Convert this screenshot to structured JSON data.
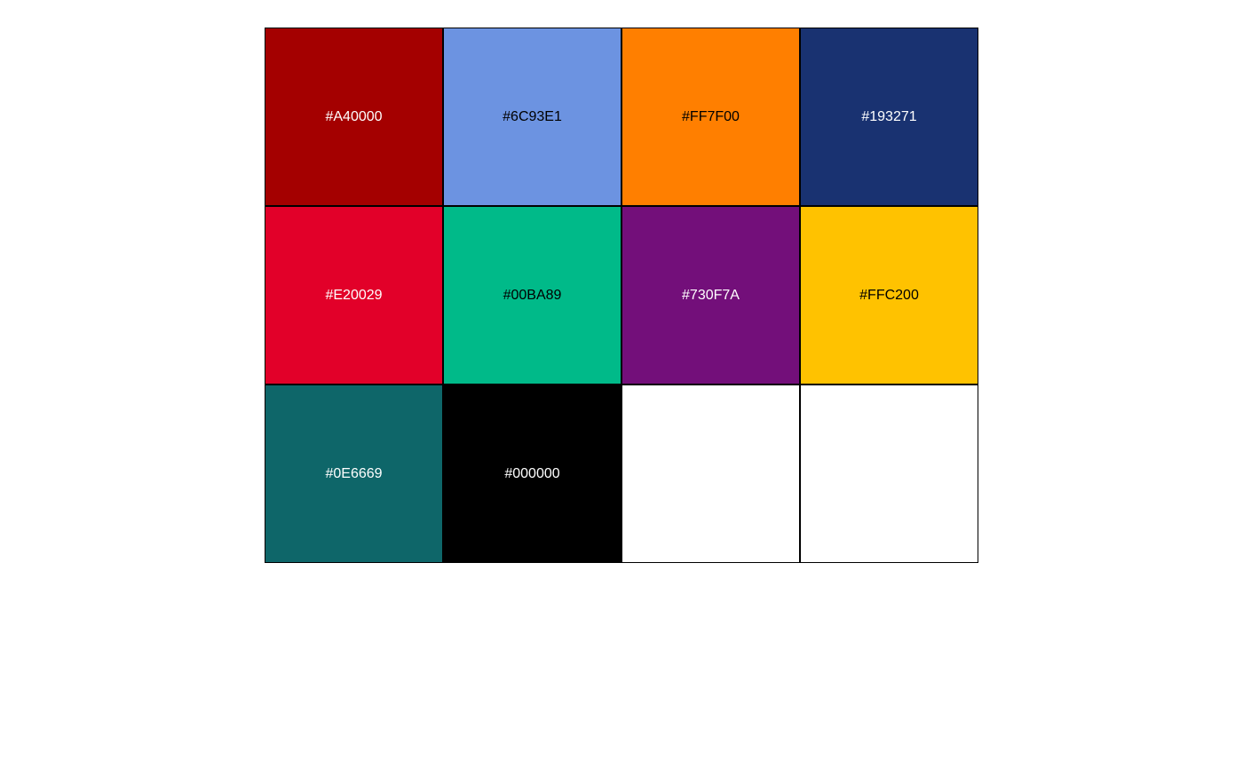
{
  "swatches": [
    {
      "hex": "#A40000",
      "label": "#A40000",
      "text_color": "#FFFFFF"
    },
    {
      "hex": "#6C93E1",
      "label": "#6C93E1",
      "text_color": "#000000"
    },
    {
      "hex": "#FF7F00",
      "label": "#FF7F00",
      "text_color": "#000000"
    },
    {
      "hex": "#193271",
      "label": "#193271",
      "text_color": "#FFFFFF"
    },
    {
      "hex": "#E20029",
      "label": "#E20029",
      "text_color": "#FFFFFF"
    },
    {
      "hex": "#00BA89",
      "label": "#00BA89",
      "text_color": "#000000"
    },
    {
      "hex": "#730F7A",
      "label": "#730F7A",
      "text_color": "#FFFFFF"
    },
    {
      "hex": "#FFC200",
      "label": "#FFC200",
      "text_color": "#000000"
    },
    {
      "hex": "#0E6669",
      "label": "#0E6669",
      "text_color": "#FFFFFF"
    },
    {
      "hex": "#000000",
      "label": "#000000",
      "text_color": "#FFFFFF"
    },
    {
      "hex": "#FFFFFF",
      "label": "",
      "text_color": "#000000"
    },
    {
      "hex": "#FFFFFF",
      "label": "",
      "text_color": "#000000"
    }
  ]
}
